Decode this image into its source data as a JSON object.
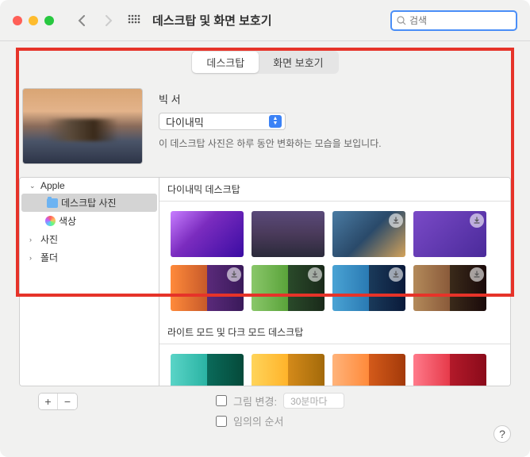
{
  "titlebar": {
    "title": "데스크탑 및 화면 보호기"
  },
  "search": {
    "placeholder": "검색"
  },
  "tabs": {
    "desktop": "데스크탑",
    "screensaver": "화면 보호기"
  },
  "current": {
    "name": "빅 서",
    "mode": "다이내믹",
    "hint": "이 데스크탑 사진은 하루 동안 변화하는 모습을 보입니다."
  },
  "sidebar": {
    "apple": "Apple",
    "desktop_photos": "데스크탑 사진",
    "colors": "색상",
    "photos": "사진",
    "folder": "폴더"
  },
  "sections": {
    "dynamic": "다이내믹 데스크탑",
    "lightdark": "라이트 모드 및 다크 모드 데스크탑"
  },
  "footer": {
    "change_label": "그림 변경:",
    "interval": "30분마다",
    "random": "임의의 순서"
  },
  "help": "?"
}
